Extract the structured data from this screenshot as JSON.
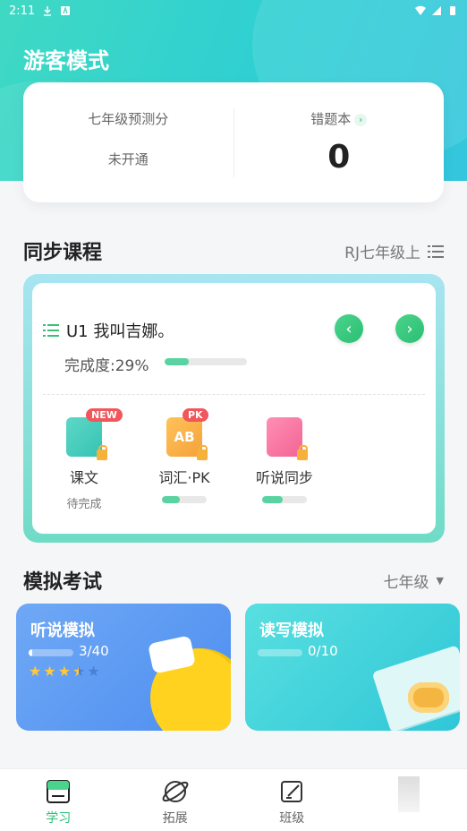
{
  "status_bar": {
    "time": "2:11"
  },
  "header": {
    "title": "游客模式"
  },
  "summary": {
    "predict_label": "七年级预测分",
    "predict_value": "未开通",
    "wrong_label": "错题本",
    "wrong_value": "0"
  },
  "sync_course": {
    "title": "同步课程",
    "book": "RJ七年级上",
    "unit": "U1 我叫吉娜。",
    "progress_label": "完成度:29%",
    "progress": 0.29,
    "items": [
      {
        "label": "课文",
        "badge": "NEW",
        "status": "待完成"
      },
      {
        "label": "词汇·PK",
        "badge": "PK",
        "icon_text": "AB",
        "progress": 0.4
      },
      {
        "label": "听说同步",
        "progress": 0.45
      }
    ]
  },
  "mock_exam": {
    "title": "模拟考试",
    "grade": "七年级",
    "cards": [
      {
        "title": "听说模拟",
        "count": "3/40",
        "progress": 0.075,
        "stars": 3.5,
        "stars_max": 5
      },
      {
        "title": "读写模拟",
        "count": "0/10",
        "progress": 0
      }
    ]
  },
  "tabs": [
    {
      "label": "学习",
      "icon": "study-icon"
    },
    {
      "label": "拓展",
      "icon": "planet-icon"
    },
    {
      "label": "班级",
      "icon": "class-icon"
    },
    {
      "label": "",
      "icon": "profile-icon"
    }
  ],
  "colors": {
    "primary": "#2bbf73",
    "teal": "#34d0c9"
  }
}
